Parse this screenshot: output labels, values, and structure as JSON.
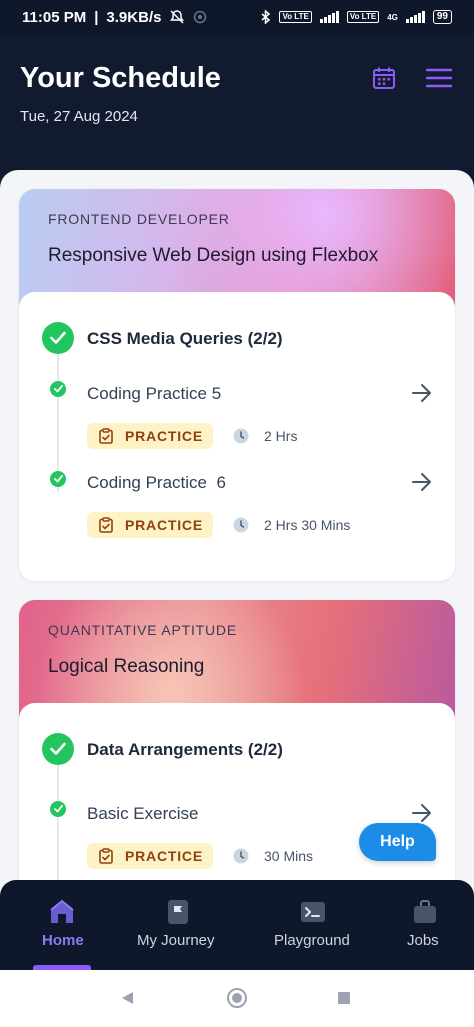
{
  "status_bar": {
    "time": "11:05 PM",
    "speed": "3.9KB/s",
    "network": "4G",
    "volte": "Vo LTE",
    "battery": "99"
  },
  "header": {
    "title": "Your Schedule",
    "date": "Tue, 27 Aug 2024"
  },
  "cards": [
    {
      "eyebrow": "FRONTEND DEVELOPER",
      "title": "Responsive Web Design using Flexbox",
      "module": "CSS Media Queries (2/2)",
      "items": [
        {
          "title": "Coding Practice 5",
          "tag": "PRACTICE",
          "duration": "2 Hrs"
        },
        {
          "title": "Coding Practice  6",
          "tag": "PRACTICE",
          "duration": "2 Hrs 30 Mins"
        }
      ]
    },
    {
      "eyebrow": "QUANTITATIVE APTITUDE",
      "title": "Logical Reasoning",
      "module": "Data Arrangements (2/2)",
      "items": [
        {
          "title": "Basic Exercise",
          "tag": "PRACTICE",
          "duration": "30 Mins"
        }
      ]
    }
  ],
  "help": {
    "label": "Help"
  },
  "bottom_nav": {
    "active": "Home",
    "items": [
      {
        "label": "Home",
        "icon": "home-icon"
      },
      {
        "label": "My Journey",
        "icon": "flag-icon"
      },
      {
        "label": "Playground",
        "icon": "terminal-icon"
      },
      {
        "label": "Jobs",
        "icon": "briefcase-icon"
      }
    ]
  },
  "colors": {
    "header_bg": "#111a2e",
    "accent": "#8b5cf6",
    "success": "#22c55e",
    "tag_bg": "#fef3c7",
    "tag_text": "#92400e",
    "help_bg": "#1d8be8"
  }
}
